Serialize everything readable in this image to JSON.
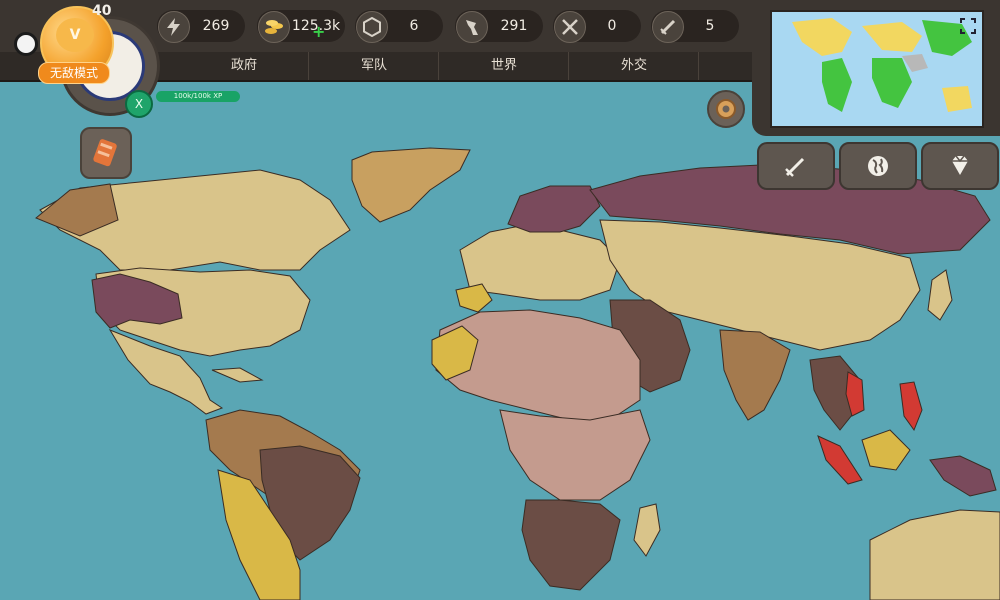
{
  "player": {
    "level": "40",
    "mode_label": "无敌模式",
    "badge_letter": "V",
    "xp_label": "100k/100k XP",
    "x_label": "X"
  },
  "resources": [
    {
      "icon": "lightning-icon",
      "value": "269"
    },
    {
      "icon": "gold-coins-icon",
      "value": "125.3k"
    },
    {
      "icon": "hexagon-icon",
      "value": "6"
    },
    {
      "icon": "soldier-icon",
      "value": "291"
    },
    {
      "icon": "crossed-swords-icon",
      "value": "0"
    },
    {
      "icon": "sword-icon",
      "value": "5"
    }
  ],
  "tabs": [
    "政府",
    "军队",
    "世界",
    "外交"
  ],
  "side_buttons": [
    "sword-icon",
    "globe-icon",
    "diamond-icon"
  ],
  "colors": {
    "ocean": "#5aa6b4",
    "land_beige": "#d9c48a",
    "land_brown": "#a47a4e",
    "land_dark": "#6b4d45",
    "land_purple": "#7a4a5c",
    "land_pink": "#c49b8e",
    "land_yellow": "#d9b847",
    "land_red": "#d23a33"
  }
}
